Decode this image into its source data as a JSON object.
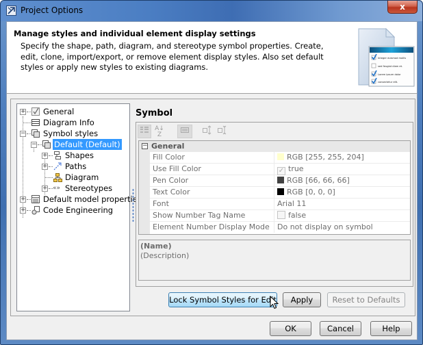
{
  "window": {
    "title": "Project Options",
    "close_label": "x"
  },
  "header": {
    "title": "Manage styles and individual element display settings",
    "description": "Specify the shape, path, diagram, and stereotype symbol properties. Create, edit, clone, import/export, or remove element display styles. Also set default styles or apply new styles to existing diagrams.",
    "illustration_items": [
      {
        "label": "Integer euismod mollis",
        "checked": true
      },
      {
        "label": "sed feugiat diam et.",
        "checked": false
      },
      {
        "label": "Lorem ipsum dolor",
        "checked": true
      },
      {
        "label": "consectetur elit.",
        "checked": true
      }
    ]
  },
  "tree": {
    "items": [
      {
        "label": "General",
        "icon": "checkbox-icon",
        "expander": "+",
        "level": 0
      },
      {
        "label": "Diagram Info",
        "icon": "table-icon",
        "expander": "",
        "level": 0
      },
      {
        "label": "Symbol styles",
        "icon": "styles-icon",
        "expander": "-",
        "level": 0
      },
      {
        "label": "Default (Default)",
        "icon": "styles-icon",
        "expander": "-",
        "level": 1,
        "selected": true
      },
      {
        "label": "Shapes",
        "icon": "shapes-icon",
        "expander": "+",
        "level": 2
      },
      {
        "label": "Paths",
        "icon": "paths-icon",
        "expander": "+",
        "level": 2
      },
      {
        "label": "Diagram",
        "icon": "diagram-icon",
        "expander": "",
        "level": 2
      },
      {
        "label": "Stereotypes",
        "icon": "stereotype-icon",
        "expander": "+",
        "level": 2
      },
      {
        "label": "Default model properties",
        "icon": "properties-icon",
        "expander": "+",
        "level": 0
      },
      {
        "label": "Code Engineering",
        "icon": "code-engineering-icon",
        "expander": "+",
        "level": 0
      }
    ]
  },
  "panel": {
    "title": "Symbol",
    "toolbar": {
      "categorized": "Categorized view",
      "alphabetical": "Sort alphabetically",
      "description": "Show description",
      "expand_all": "Expand all",
      "collapse_all": "Collapse all"
    },
    "category": {
      "label": "General",
      "expander": "-"
    },
    "properties": [
      {
        "name": "Fill Color",
        "value": "RGB [255, 255, 204]",
        "swatch": "#ffffcc"
      },
      {
        "name": "Use Fill Color",
        "value": "true",
        "checkbox": true
      },
      {
        "name": "Pen Color",
        "value": "RGB [66, 66, 66]",
        "swatch": "#424242"
      },
      {
        "name": "Text Color",
        "value": "RGB [0, 0, 0]",
        "swatch": "#000000"
      },
      {
        "name": "Font",
        "value": "Arial 11"
      },
      {
        "name": "Show Number Tag Name",
        "value": "false",
        "checkbox": false
      },
      {
        "name": "Element Number Display Mode",
        "value": "Do not display on symbol"
      }
    ],
    "description_box": {
      "name": "(Name)",
      "description": "(Description)"
    }
  },
  "buttons": {
    "lock": "Lock Symbol Styles for Edit",
    "apply": "Apply",
    "reset": "Reset to Defaults",
    "ok": "OK",
    "cancel": "Cancel",
    "help": "Help"
  }
}
